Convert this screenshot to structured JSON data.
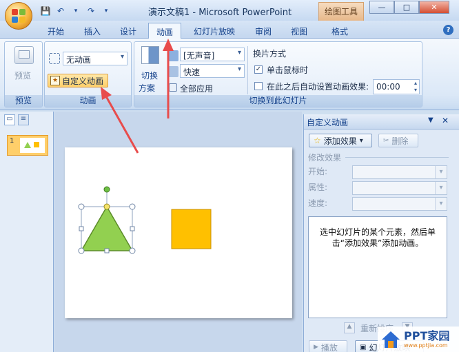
{
  "window": {
    "title": "演示文稿1 - Microsoft PowerPoint",
    "contextual_tab": "绘图工具",
    "buttons": {
      "minimize": "—",
      "restore": "□",
      "close": "✕"
    }
  },
  "qat": {
    "save": "💾",
    "undo": "↶",
    "redo": "↷",
    "customize": "▾"
  },
  "tabs": [
    {
      "label": "开始"
    },
    {
      "label": "插入"
    },
    {
      "label": "设计"
    },
    {
      "label": "动画"
    },
    {
      "label": "幻灯片放映"
    },
    {
      "label": "审阅"
    },
    {
      "label": "视图"
    },
    {
      "label": "格式"
    }
  ],
  "ribbon": {
    "preview_group": {
      "button": "预览",
      "label": "预览"
    },
    "animation_group": {
      "animate_value": "无动画",
      "custom_animation": "自定义动画",
      "label": "动画"
    },
    "transition_group": {
      "scheme_label_1": "切换",
      "scheme_label_2": "方案",
      "sound_value": "[无声音]",
      "speed_value": "快速",
      "apply_all": "全部应用",
      "advance_title": "换片方式",
      "on_click": "单击鼠标时",
      "auto_after": "在此之后自动设置动画效果:",
      "time_value": "00:00",
      "label": "切换到此幻灯片"
    }
  },
  "slides_panel": {
    "tab1": "▭",
    "tab2": "≡",
    "slide_number": "1"
  },
  "task_pane": {
    "title": "自定义动画",
    "add_effect": "添加效果",
    "remove": "删除",
    "modify_title": "修改效果",
    "start_label": "开始:",
    "property_label": "属性:",
    "speed_label": "速度:",
    "info_text": "选中幻灯片的某个元素，然后单击“添加效果”添加动画。",
    "reorder": "重新排序",
    "play": "播放",
    "slideshow": "幻灯片放映"
  },
  "watermark": {
    "text": "PPT家园",
    "url": "www.pptjia.com"
  },
  "colors": {
    "triangle": "#92d050",
    "square": "#ffc000",
    "arrow": "#e84c4c",
    "handle_green": "#6ec043",
    "handle_yellow": "#f5e36a"
  }
}
